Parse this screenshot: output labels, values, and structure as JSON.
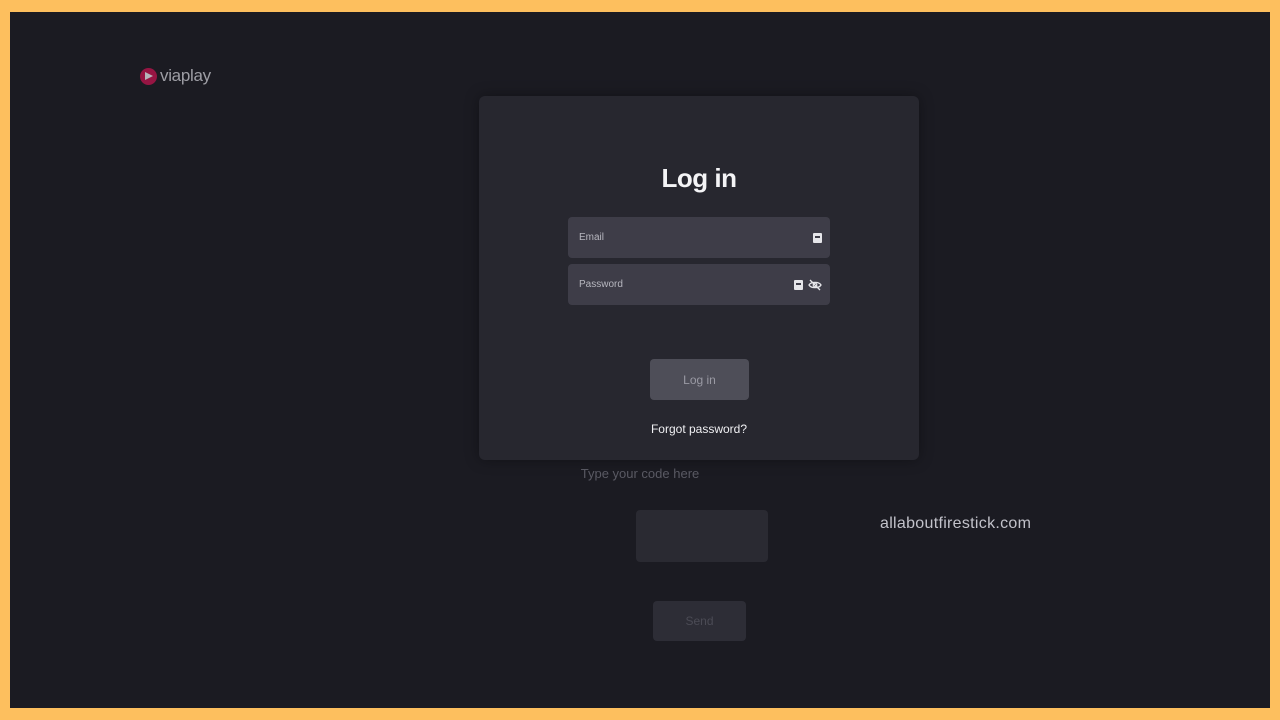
{
  "brand": {
    "name": "viaplay",
    "color": "#C0134E"
  },
  "login": {
    "title": "Log in",
    "email_placeholder": "Email",
    "password_placeholder": "Password",
    "submit_label": "Log in",
    "forgot_label": "Forgot password?"
  },
  "code_entry": {
    "hint": "Type your code here",
    "send_label": "Send"
  },
  "watermark": "allaboutfirestick.com",
  "colors": {
    "frame": "#FDBF5E",
    "background": "#1B1B22",
    "card": "#27272F",
    "field": "#3E3D48"
  },
  "icons": [
    "viaplay-logo-icon",
    "key-icon",
    "eye-off-icon"
  ]
}
